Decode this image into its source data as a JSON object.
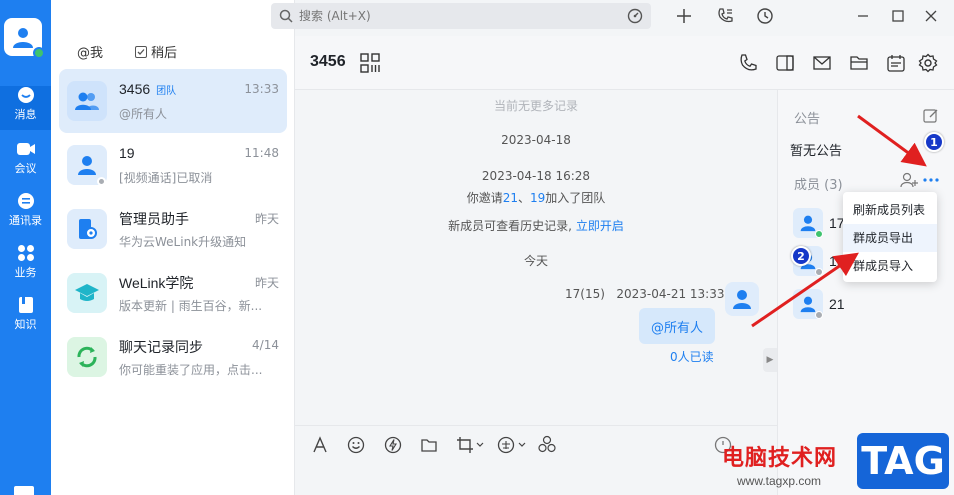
{
  "search": {
    "placeholder": "搜索 (Alt+X)"
  },
  "nav": {
    "items": [
      {
        "label": "消息",
        "icon": "message-icon"
      },
      {
        "label": "会议",
        "icon": "video-icon"
      },
      {
        "label": "通讯录",
        "icon": "contacts-icon"
      },
      {
        "label": "业务",
        "icon": "apps-icon"
      },
      {
        "label": "知识",
        "icon": "book-icon"
      }
    ]
  },
  "filters": {
    "mention": "@我",
    "later": "稍后"
  },
  "conversations": [
    {
      "name": "3456",
      "tag": "团队",
      "time": "13:33",
      "preview": "@所有人"
    },
    {
      "name": "19",
      "tag": "",
      "time": "11:48",
      "preview": "[视频通话]已取消"
    },
    {
      "name": "管理员助手",
      "tag": "",
      "time": "昨天",
      "preview": "华为云WeLink升级通知"
    },
    {
      "name": "WeLink学院",
      "tag": "",
      "time": "昨天",
      "preview": "版本更新 | 雨生百谷，新..."
    },
    {
      "name": "聊天记录同步",
      "tag": "",
      "time": "4/14",
      "preview": "你可能重装了应用，点击..."
    }
  ],
  "chat": {
    "title": "3456",
    "no_more": "当前无更多记录",
    "date1": "2023-04-18",
    "datetime": "2023-04-18 16:28",
    "invite_pre": "你邀请",
    "invite_a": "21",
    "invite_sep": "、",
    "invite_b": "19",
    "invite_post": "加入了团队",
    "history_text": "新成员可查看历史记录,",
    "history_link": "立即开启",
    "today": "今天",
    "msg_sender": "17(15)",
    "msg_time": "2023-04-21 13:33",
    "msg_text": "@所有人",
    "read_status": "0人已读"
  },
  "side": {
    "notice_label": "公告",
    "notice_text": "暂无公告",
    "members_label": "成员 (3)",
    "members": [
      {
        "name": "17",
        "status_color": "#3fc36e"
      },
      {
        "name": "19",
        "status_color": "#a9adb3"
      },
      {
        "name": "21",
        "status_color": "#a9adb3"
      }
    ]
  },
  "menu": {
    "items": [
      "刷新成员列表",
      "群成员导出",
      "群成员导入"
    ]
  },
  "badges": {
    "one": "1",
    "two": "2"
  },
  "watermark": {
    "site": "电脑技术网",
    "url": "www.tagxp.com",
    "tag": "TAG"
  },
  "colors": {
    "accent": "#1e7ff0",
    "rail": "#1e7ff0",
    "arrow": "#e02020",
    "badge": "#1638c8"
  }
}
